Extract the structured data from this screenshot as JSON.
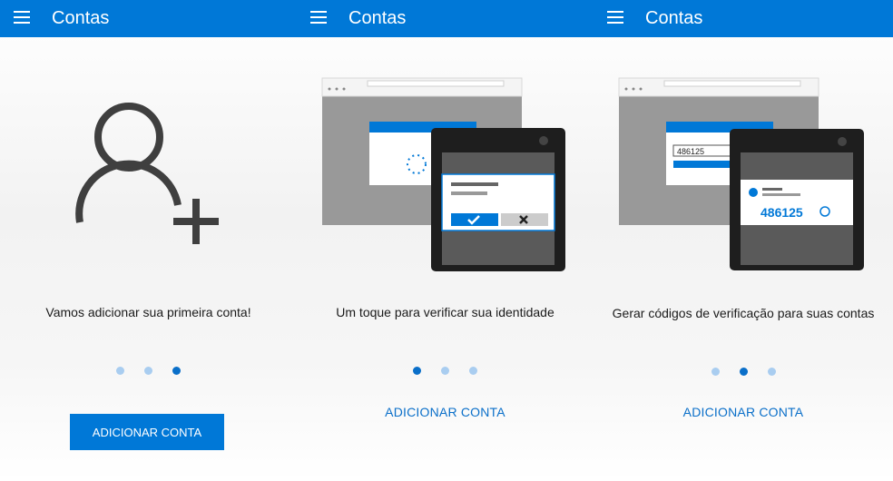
{
  "panels": [
    {
      "title": "Contas",
      "caption": "Vamos adicionar sua primeira conta!",
      "button_label": "ADICIONAR CONTA",
      "active_dot": 3
    },
    {
      "title": "Contas",
      "caption": "Um toque para verificar sua identidade",
      "button_label": "ADICIONAR CONTA",
      "active_dot": 1
    },
    {
      "title": "Contas",
      "caption": "Gerar códigos de verificação para suas contas",
      "button_label": "ADICIONAR CONTA",
      "active_dot": 2,
      "code_input": "486125",
      "code_phone": "486125"
    }
  ],
  "colors": {
    "accent": "#0078d7",
    "dot_active": "#0a6fc9",
    "dot_inactive": "#a9cdf0"
  },
  "icons": {
    "menu": "hamburger-icon",
    "person_add": "person-add-icon"
  }
}
